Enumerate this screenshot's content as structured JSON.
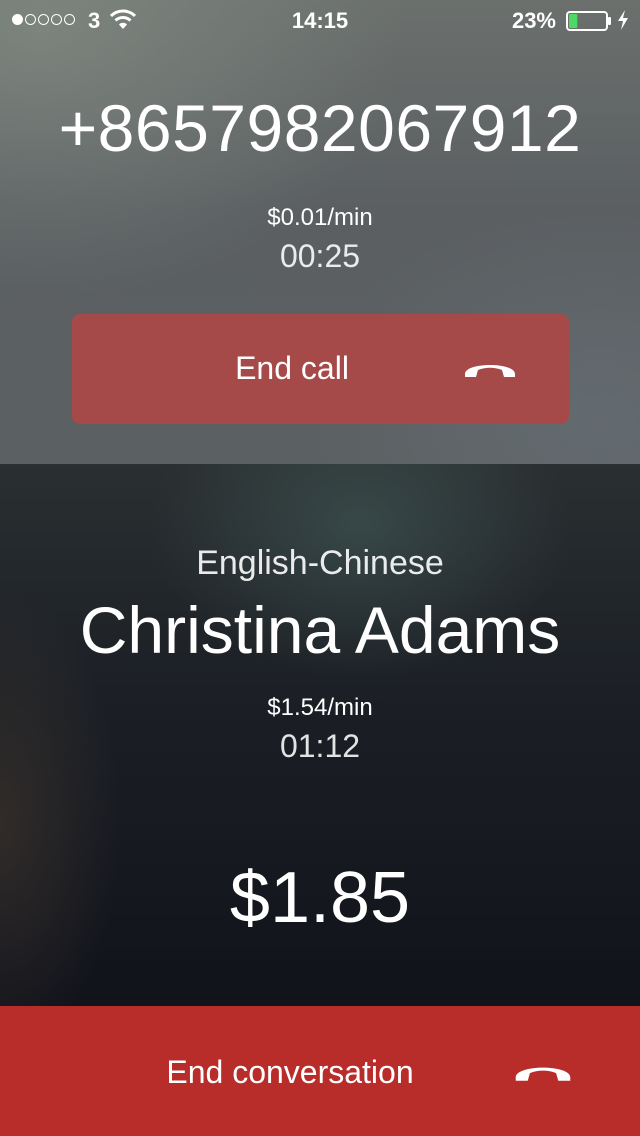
{
  "status_bar": {
    "signal_bars_filled": 1,
    "signal_bars_total": 5,
    "carrier": "3",
    "time": "14:15",
    "battery_percent": "23%",
    "battery_level": 0.23,
    "battery_color": "#4cd964",
    "charging": true
  },
  "call": {
    "phone_number": "+8657982067912",
    "rate": "$0.01/min",
    "duration": "00:25",
    "end_button_label": "End call",
    "end_button_color": "#a54a48",
    "end_button_icon": "phone-hangup-icon"
  },
  "interpreter": {
    "language_pair": "English-Chinese",
    "name": "Christina Adams",
    "rate": "$1.54/min",
    "duration": "01:12"
  },
  "total": {
    "cost": "$1.85"
  },
  "end_conversation": {
    "label": "End conversation",
    "color": "#b82c2a",
    "icon": "phone-hangup-icon"
  }
}
